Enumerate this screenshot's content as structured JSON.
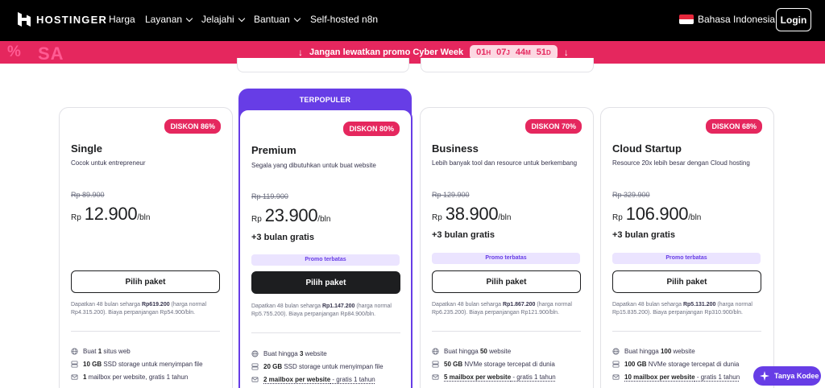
{
  "header": {
    "brand": "HOSTINGER",
    "nav": [
      {
        "label": "Harga",
        "dropdown": false
      },
      {
        "label": "Layanan",
        "dropdown": true
      },
      {
        "label": "Jelajahi",
        "dropdown": true
      },
      {
        "label": "Bantuan",
        "dropdown": true
      },
      {
        "label": "Self-hosted n8n",
        "dropdown": false
      }
    ],
    "language": "Bahasa Indonesia",
    "login_label": "Login"
  },
  "promo_bar": {
    "deco_pct": "%",
    "deco_text": "SA",
    "message": "Jangan lewatkan promo Cyber Week",
    "countdown": [
      {
        "value": "01",
        "unit": "H"
      },
      {
        "value": "07",
        "unit": "J"
      },
      {
        "value": "44",
        "unit": "M"
      },
      {
        "value": "51",
        "unit": "D"
      }
    ],
    "color": "#e5275e"
  },
  "popular_label": "TERPOPULER",
  "plans": [
    {
      "name": "Single",
      "badge": "DISKON 86%",
      "description": "Cocok untuk entrepreneur",
      "old_price": "Rp 89.900",
      "currency": "Rp",
      "price": "12.900",
      "period": "/bln",
      "bonus": "",
      "promo_tag": "",
      "button": "Pilih paket",
      "fine_pre": "Dapatkan 48 bulan seharga ",
      "fine_bold": "Rp619.200",
      "fine_post": " (harga normal Rp4.315.200). Biaya perpanjangan Rp54.900/bln.",
      "features": [
        {
          "icon": "globe-icon",
          "pre": "Buat ",
          "bold": "1",
          "post": " situs web",
          "underline": false
        },
        {
          "icon": "storage-icon",
          "pre": "",
          "bold": "10 GB",
          "post": " SSD storage untuk menyimpan file",
          "underline": false
        },
        {
          "icon": "mail-icon",
          "pre": "",
          "bold": "1",
          "post": " mailbox per website, gratis 1 tahun",
          "underline": false
        }
      ]
    },
    {
      "name": "Premium",
      "badge": "DISKON 80%",
      "description": "Segala yang dibutuhkan untuk buat website",
      "old_price": "Rp 119.900",
      "currency": "Rp",
      "price": "23.900",
      "period": "/bln",
      "bonus": "+3 bulan gratis",
      "promo_tag": "Promo terbatas",
      "button": "Pilih paket",
      "fine_pre": "Dapatkan 48 bulan seharga ",
      "fine_bold": "Rp1.147.200",
      "fine_post": " (harga normal Rp5.755.200). Biaya perpanjangan Rp84.900/bln.",
      "features": [
        {
          "icon": "globe-icon",
          "pre": "Buat hingga ",
          "bold": "3",
          "post": " website",
          "underline": false
        },
        {
          "icon": "storage-icon",
          "pre": "",
          "bold": "20 GB",
          "post": " SSD storage untuk menyimpan file",
          "underline": false
        },
        {
          "icon": "mail-icon",
          "pre": "",
          "bold": "2 mailbox per website",
          "post": " - gratis 1 tahun",
          "underline": true
        }
      ]
    },
    {
      "name": "Business",
      "badge": "DISKON 70%",
      "description": "Lebih banyak tool dan resource untuk berkembang",
      "old_price": "Rp 129.900",
      "currency": "Rp",
      "price": "38.900",
      "period": "/bln",
      "bonus": "+3 bulan gratis",
      "promo_tag": "Promo terbatas",
      "button": "Pilih paket",
      "fine_pre": "Dapatkan 48 bulan seharga ",
      "fine_bold": "Rp1.867.200",
      "fine_post": " (harga normal Rp6.235.200). Biaya perpanjangan Rp121.900/bln.",
      "features": [
        {
          "icon": "globe-icon",
          "pre": "Buat hingga ",
          "bold": "50",
          "post": " website",
          "underline": false
        },
        {
          "icon": "storage-icon",
          "pre": "",
          "bold": "50 GB",
          "post": " NVMe storage tercepat di dunia",
          "underline": false
        },
        {
          "icon": "mail-icon",
          "pre": "",
          "bold": "5 mailbox per website",
          "post": " - gratis 1 tahun",
          "underline": true
        }
      ]
    },
    {
      "name": "Cloud Startup",
      "badge": "DISKON 68%",
      "description": "Resource 20x lebih besar dengan Cloud hosting",
      "old_price": "Rp 329.900",
      "currency": "Rp",
      "price": "106.900",
      "period": "/bln",
      "bonus": "+3 bulan gratis",
      "promo_tag": "Promo terbatas",
      "button": "Pilih paket",
      "fine_pre": "Dapatkan 48 bulan seharga ",
      "fine_bold": "Rp5.131.200",
      "fine_post": " (harga normal Rp15.835.200). Biaya perpanjangan Rp310.900/bln.",
      "features": [
        {
          "icon": "globe-icon",
          "pre": "Buat hingga ",
          "bold": "100",
          "post": " website",
          "underline": false
        },
        {
          "icon": "storage-icon",
          "pre": "",
          "bold": "100 GB",
          "post": " NVMe storage tercepat di dunia",
          "underline": false
        },
        {
          "icon": "mail-icon",
          "pre": "",
          "bold": "10 mailbox per website",
          "post": " - gratis 1 tahun",
          "underline": true
        }
      ]
    }
  ],
  "chat_label": "Tanya Kodee",
  "colors": {
    "brand_purple": "#673de6",
    "promo_pink": "#e5275e",
    "dark": "#1d1e20"
  }
}
